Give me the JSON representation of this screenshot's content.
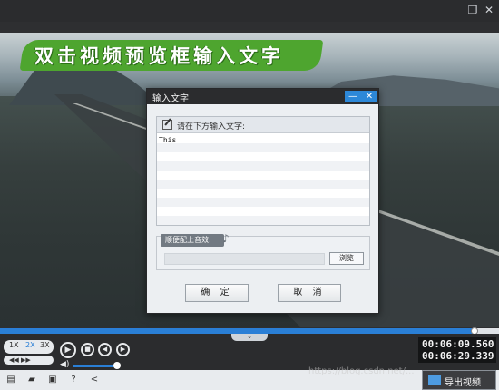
{
  "window": {
    "restore_icon": "restore-icon",
    "close_icon": "close-icon"
  },
  "preview": {
    "banner_text": "双击视频预览框输入文字"
  },
  "dialog": {
    "title": "输入文字",
    "minimize_label": "—",
    "close_label": "✕",
    "text_panel_label": "请在下方输入文字:",
    "text_value": "This",
    "music_label": "顺便配上音效:",
    "music_path": "",
    "browse_label": "浏览",
    "ok_label": "确 定",
    "cancel_label": "取 消"
  },
  "player": {
    "progress_fraction": 0.95,
    "speed_options": [
      "1X",
      "2X",
      "3X"
    ],
    "selected_speed": "2X",
    "seek_label": "◀◀ ▶▶",
    "volume_fraction": 0.95,
    "time_current": "00:06:09.560",
    "time_total": "00:06:29.339"
  },
  "toolbar": {
    "export_label": "导出视频"
  },
  "watermark": "https://blog.csdn.net/..."
}
